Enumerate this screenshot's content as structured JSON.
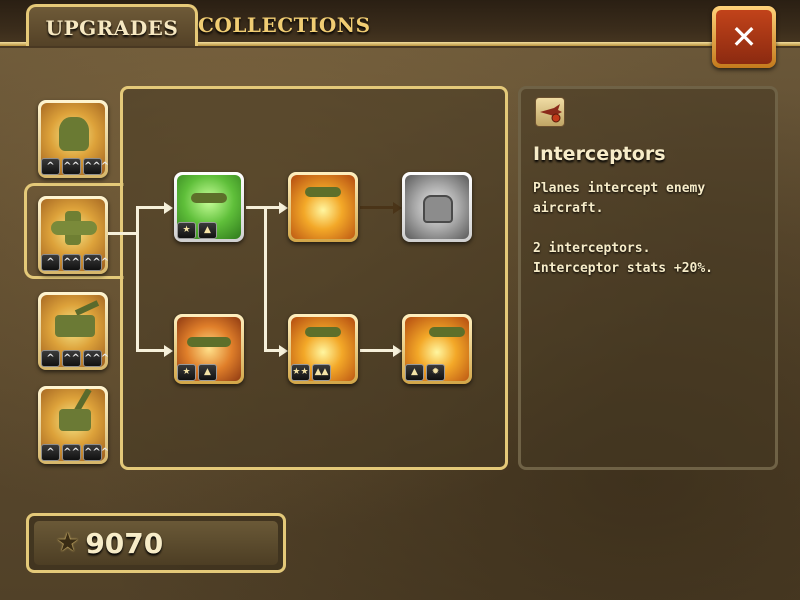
{
  "tabs": [
    {
      "label": "UPGRADES",
      "active": true
    },
    {
      "label": "COLLECTIONS",
      "active": false
    }
  ],
  "close_button": {
    "label": "✕",
    "icon": "close-icon"
  },
  "units": [
    {
      "name": "soldier",
      "icon": "soldier-icon",
      "ranks": [
        "^",
        "^^",
        "^^^"
      ]
    },
    {
      "name": "plane",
      "icon": "plane-icon",
      "selected": true,
      "ranks": [
        "^",
        "^^",
        "^^^"
      ]
    },
    {
      "name": "artillery",
      "icon": "artillery-icon",
      "ranks": [
        "^",
        "^^",
        "^^^"
      ]
    },
    {
      "name": "anti-air",
      "icon": "anti-air-icon",
      "ranks": [
        "^",
        "^^",
        "^^^"
      ]
    }
  ],
  "upgrade_nodes": [
    {
      "id": "interceptors",
      "image": "green",
      "badges": [
        "★",
        "▲"
      ],
      "selected": true
    },
    {
      "id": "node-fire-1",
      "image": "fire",
      "badges": []
    },
    {
      "id": "node-locked",
      "image": "grey",
      "badges": [],
      "locked": true
    },
    {
      "id": "node-plane-2",
      "image": "plane",
      "badges": [
        "★",
        "▲"
      ]
    },
    {
      "id": "node-fire-2",
      "image": "fire",
      "badges": [
        "★★",
        "▲▲"
      ]
    },
    {
      "id": "node-fire-3",
      "image": "fire",
      "badges": [
        "▲",
        "✹"
      ]
    }
  ],
  "detail": {
    "icon": "plane-shield-icon",
    "title": "Interceptors",
    "lines": [
      "Planes intercept enemy",
      "aircraft.",
      "",
      "2 interceptors.",
      "Interceptor stats +20%."
    ]
  },
  "currency": {
    "icon": "star-icon",
    "amount": "9070"
  },
  "colors": {
    "frame_gold": "#e4c979",
    "text_cream": "#f7ecc8",
    "tab_inactive": "#f1cd73",
    "close_red": "#c2431a"
  }
}
